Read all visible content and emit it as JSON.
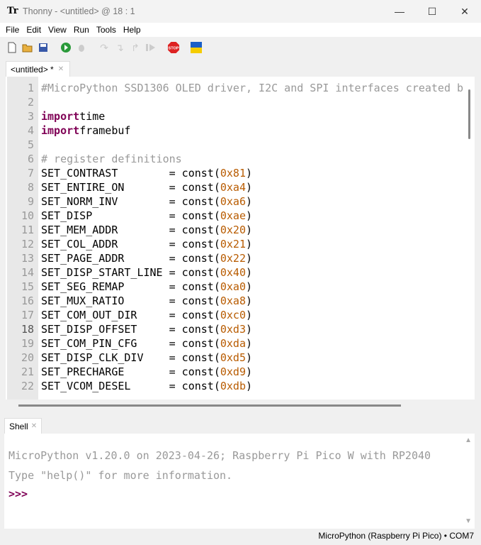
{
  "window": {
    "title": "Thonny  -  <untitled>  @  18 : 1",
    "minimize": "—",
    "maximize": "☐",
    "close": "✕"
  },
  "menu": [
    "File",
    "Edit",
    "View",
    "Run",
    "Tools",
    "Help"
  ],
  "toolbar": {
    "icons": [
      "new-file-icon",
      "open-folder-icon",
      "save-icon",
      "run-icon",
      "debug-icon",
      "step-over-icon",
      "step-into-icon",
      "step-out-icon",
      "resume-icon",
      "stop-icon",
      "ukraine-flag-icon"
    ],
    "stop_label": "STOP"
  },
  "editor": {
    "tab": "<untitled> *",
    "current_line": 18,
    "lines": [
      [
        [
          "cm",
          "#MicroPython SSD1306 OLED driver, I2C and SPI interfaces created b"
        ]
      ],
      [],
      [
        [
          "kw",
          "import"
        ],
        [
          "",
          "time"
        ]
      ],
      [
        [
          "kw",
          "import"
        ],
        [
          "",
          "framebuf"
        ]
      ],
      [],
      [
        [
          "cm",
          "# register definitions"
        ]
      ],
      [
        [
          "",
          "SET_CONTRAST        = const("
        ],
        [
          "num",
          "0x81"
        ],
        [
          "",
          ")"
        ]
      ],
      [
        [
          "",
          "SET_ENTIRE_ON       = const("
        ],
        [
          "num",
          "0xa4"
        ],
        [
          "",
          ")"
        ]
      ],
      [
        [
          "",
          "SET_NORM_INV        = const("
        ],
        [
          "num",
          "0xa6"
        ],
        [
          "",
          ")"
        ]
      ],
      [
        [
          "",
          "SET_DISP            = const("
        ],
        [
          "num",
          "0xae"
        ],
        [
          "",
          ")"
        ]
      ],
      [
        [
          "",
          "SET_MEM_ADDR        = const("
        ],
        [
          "num",
          "0x20"
        ],
        [
          "",
          ")"
        ]
      ],
      [
        [
          "",
          "SET_COL_ADDR        = const("
        ],
        [
          "num",
          "0x21"
        ],
        [
          "",
          ")"
        ]
      ],
      [
        [
          "",
          "SET_PAGE_ADDR       = const("
        ],
        [
          "num",
          "0x22"
        ],
        [
          "",
          ")"
        ]
      ],
      [
        [
          "",
          "SET_DISP_START_LINE = const("
        ],
        [
          "num",
          "0x40"
        ],
        [
          "",
          ")"
        ]
      ],
      [
        [
          "",
          "SET_SEG_REMAP       = const("
        ],
        [
          "num",
          "0xa0"
        ],
        [
          "",
          ")"
        ]
      ],
      [
        [
          "",
          "SET_MUX_RATIO       = const("
        ],
        [
          "num",
          "0xa8"
        ],
        [
          "",
          ")"
        ]
      ],
      [
        [
          "",
          "SET_COM_OUT_DIR     = const("
        ],
        [
          "num",
          "0xc0"
        ],
        [
          "",
          ")"
        ]
      ],
      [
        [
          "",
          "SET_DISP_OFFSET     = const("
        ],
        [
          "num",
          "0xd3"
        ],
        [
          "",
          ")"
        ]
      ],
      [
        [
          "",
          "SET_COM_PIN_CFG     = const("
        ],
        [
          "num",
          "0xda"
        ],
        [
          "",
          ")"
        ]
      ],
      [
        [
          "",
          "SET_DISP_CLK_DIV    = const("
        ],
        [
          "num",
          "0xd5"
        ],
        [
          "",
          ")"
        ]
      ],
      [
        [
          "",
          "SET_PRECHARGE       = const("
        ],
        [
          "num",
          "0xd9"
        ],
        [
          "",
          ")"
        ]
      ],
      [
        [
          "",
          "SET_VCOM_DESEL      = const("
        ],
        [
          "num",
          "0xdb"
        ],
        [
          "",
          ")"
        ]
      ]
    ]
  },
  "shell": {
    "tab": "Shell",
    "banner": "MicroPython v1.20.0 on 2023-04-26; Raspberry Pi Pico W with RP2040",
    "help": "Type \"help()\" for more information.",
    "prompt": ">>>"
  },
  "status": "MicroPython (Raspberry Pi Pico)  •  COM7"
}
